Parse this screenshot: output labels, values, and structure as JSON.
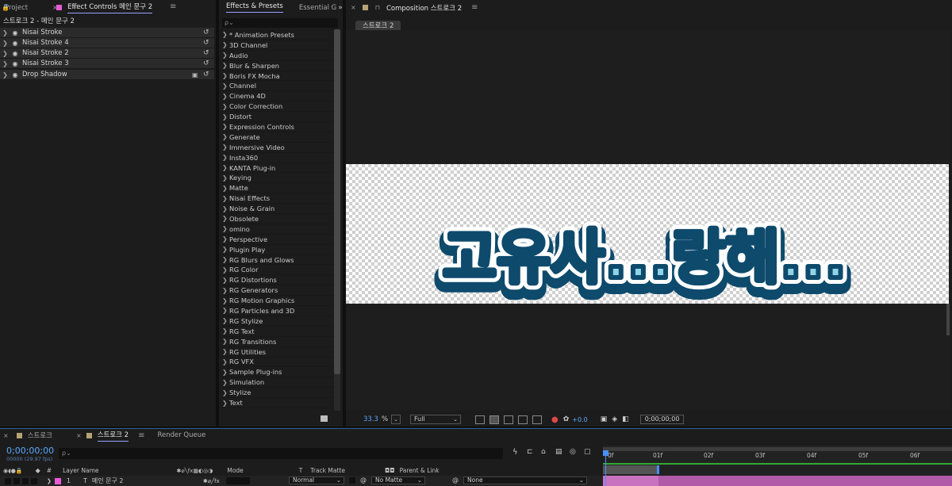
{
  "project_tab": {
    "label": "Project"
  },
  "effect_controls": {
    "tab_label": "Effect Controls 메인 문구 2",
    "title": "스트로크 2 - 메인 문구 2",
    "effects": [
      "Nisai Stroke",
      "Nisai Stroke 4",
      "Nisai Stroke 2",
      "Nisai Stroke 3",
      "Drop Shadow"
    ]
  },
  "effects_presets": {
    "tab_label": "Effects & Presets",
    "tab2_label": "Essential G",
    "search_placeholder": "ρ⌄",
    "items": [
      "* Animation Presets",
      "3D Channel",
      "Audio",
      "Blur & Sharpen",
      "Boris FX Mocha",
      "Channel",
      "Cinema 4D",
      "Color Correction",
      "Distort",
      "Expression Controls",
      "Generate",
      "Immersive Video",
      "Insta360",
      "KANTA Plug-in",
      "Keying",
      "Matte",
      "Nisai Effects",
      "Noise & Grain",
      "Obsolete",
      "omino",
      "Perspective",
      "Plugin Play",
      "RG Blurs and Glows",
      "RG Color",
      "RG Distortions",
      "RG Generators",
      "RG Motion Graphics",
      "RG Particles and 3D",
      "RG Stylize",
      "RG Text",
      "RG Transitions",
      "RG Utilities",
      "RG VFX",
      "Sample Plug-ins",
      "Simulation",
      "Stylize",
      "Text"
    ]
  },
  "composition": {
    "tab_label": "Composition 스트로크 2",
    "chip": "스트로크 2",
    "artwork_text": "고유사...랑해...",
    "zoom": "33.3",
    "zoom_unit": "%",
    "resolution": "Full",
    "exposure": "+0.0",
    "timecode": "0;00;00;00"
  },
  "timeline": {
    "tabs": [
      "스트로크",
      "스트로크 2",
      "Render Queue"
    ],
    "timecode": "0;00;00;00",
    "fps": "00000 (29.97 fps)",
    "search_placeholder": "ρ⌄",
    "columns": {
      "layer_name": "Layer Name",
      "mode": "Mode",
      "t": "T",
      "track_matte": "Track Matte",
      "parent": "Parent & Link"
    },
    "layer": {
      "index": "1",
      "type_glyph": "T",
      "name": "메인 문구 2",
      "mode": "Normal",
      "matte": "No Matte",
      "parent": "None"
    },
    "ruler": [
      "0f",
      "01f",
      "02f",
      "03f",
      "04f",
      "05f",
      "06f"
    ]
  },
  "colors": {
    "accent_blue": "#5aa8ff",
    "label_pink": "#e85ad8",
    "label_tan": "#b5a374",
    "artwork_outline": "#0e4a6c",
    "artwork_fill": "#8fd3e8"
  }
}
